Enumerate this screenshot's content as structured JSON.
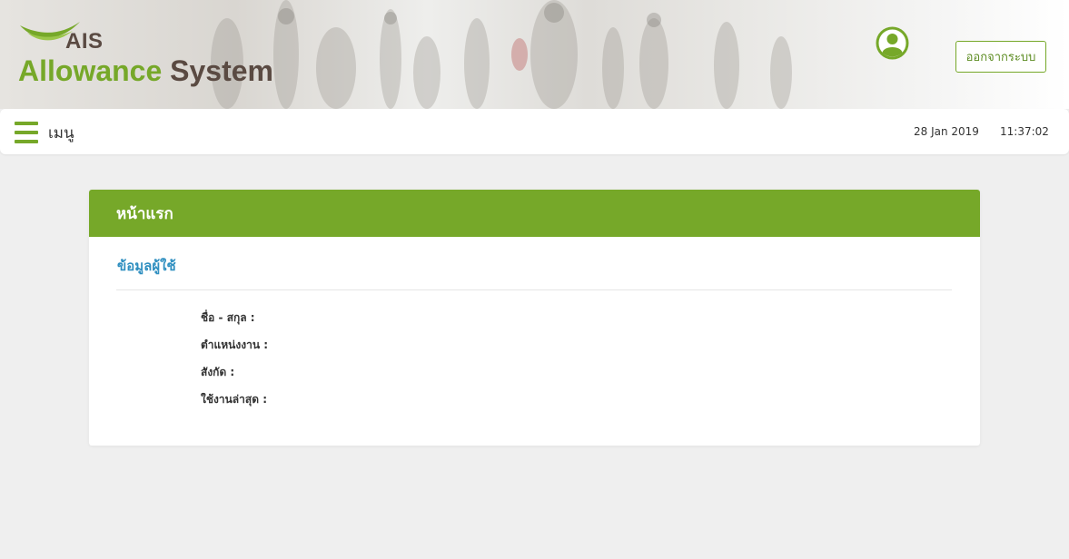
{
  "header": {
    "logo": {
      "brand": "AIS",
      "word1": "Allowance",
      "word2": "System"
    },
    "logout_label": "ออกจากระบบ"
  },
  "navbar": {
    "menu_label": "เมนู",
    "date": "28 Jan 2019",
    "time": "11:37:02"
  },
  "panel": {
    "title": "หน้าแรก",
    "section_title": "ข้อมูลผู้ใช้",
    "fields": [
      {
        "label": "ชื่อ - สกุล :"
      },
      {
        "label": "ตำแหน่งงาน :"
      },
      {
        "label": "สังกัด :"
      },
      {
        "label": "ใช้งานล่าสุด :"
      }
    ]
  },
  "colors": {
    "brand_green": "#76a829",
    "brand_brown": "#5a4a42",
    "section_blue": "#2f8fc0",
    "page_bg": "#efefef"
  },
  "icons": [
    "ais-swoosh-icon",
    "user-icon",
    "hamburger-icon"
  ]
}
